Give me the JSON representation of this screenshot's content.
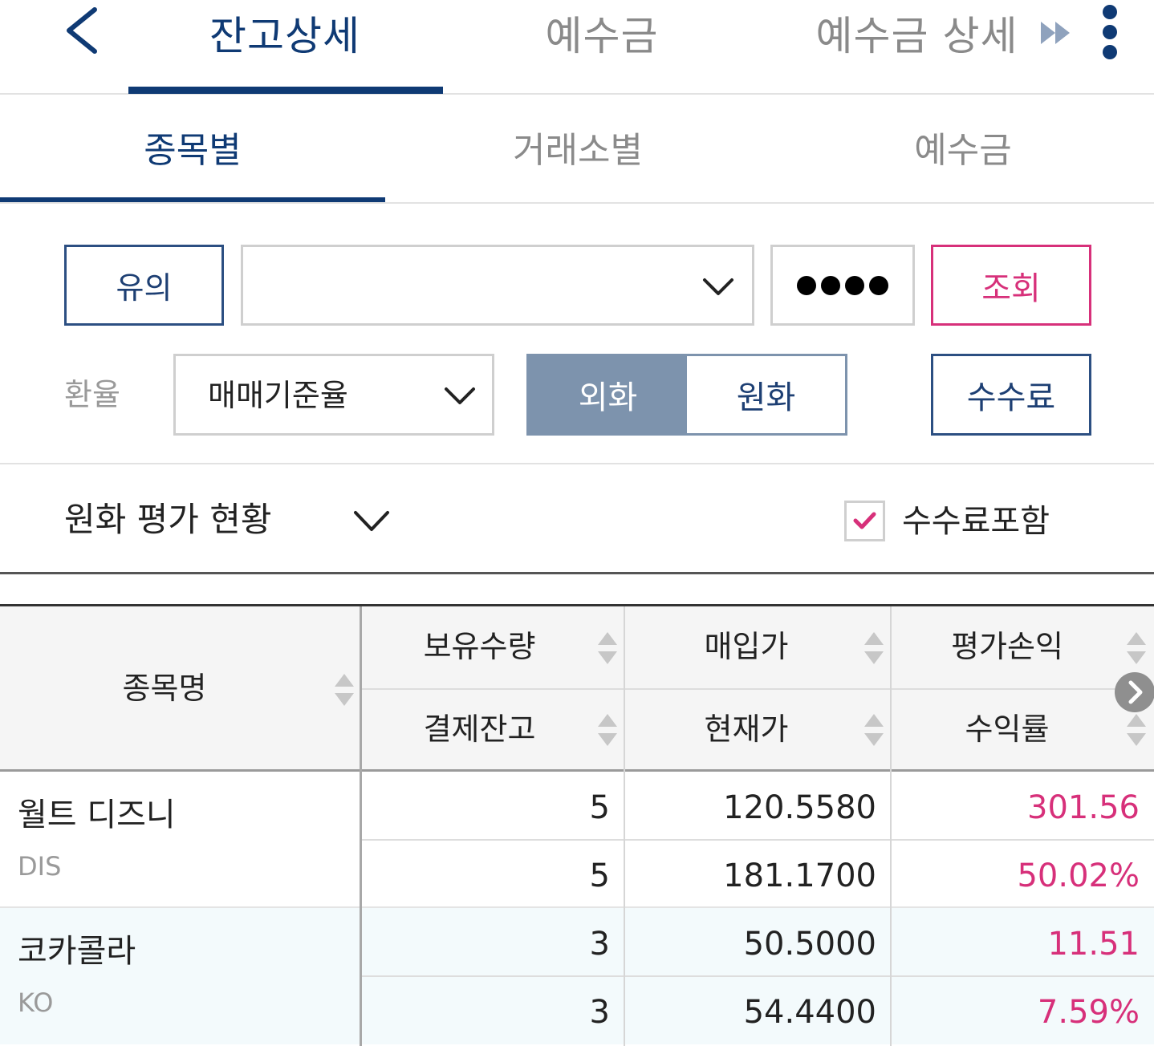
{
  "top_tabs": [
    {
      "label": "잔고상세",
      "active": true
    },
    {
      "label": "예수금",
      "active": false
    },
    {
      "label": "예수금 상세",
      "active": false
    }
  ],
  "sub_tabs": [
    {
      "label": "종목별",
      "active": true
    },
    {
      "label": "거래소별",
      "active": false
    },
    {
      "label": "예수금",
      "active": false
    }
  ],
  "controls": {
    "notice_label": "유의",
    "account_value": "",
    "password_dots": 4,
    "query_label": "조회",
    "fx_label": "환율",
    "fx_select_value": "매매기준율",
    "currency_toggle": [
      {
        "label": "외화",
        "selected": true
      },
      {
        "label": "원화",
        "selected": false
      }
    ],
    "fee_label": "수수료"
  },
  "summary": {
    "title": "원화 평가 현황",
    "fee_include_label": "수수료포함",
    "fee_include_checked": true
  },
  "table": {
    "headers": {
      "name": "종목명",
      "col1_top": "보유수량",
      "col1_bottom": "결제잔고",
      "col2_top": "매입가",
      "col2_bottom": "현재가",
      "col3_top": "평가손익",
      "col3_bottom": "수익률"
    },
    "rows": [
      {
        "name": "월트 디즈니",
        "code": "DIS",
        "qty": "5",
        "settle": "5",
        "buy_price": "120.5580",
        "current_price": "181.1700",
        "pnl": "301.56",
        "return_rate": "50.02%"
      },
      {
        "name": "코카콜라",
        "code": "KO",
        "qty": "3",
        "settle": "3",
        "buy_price": "50.5000",
        "current_price": "54.4400",
        "pnl": "11.51",
        "return_rate": "7.59%"
      }
    ]
  },
  "colors": {
    "navy": "#0f3a74",
    "accent_pink": "#d7307a",
    "toggle_gray": "#7d93ad"
  },
  "icons": {
    "back": "chevron-left-icon",
    "forward": "fast-forward-icon",
    "more": "more-vertical-icon",
    "dropdown": "chevron-down-icon",
    "sort": "sort-icon",
    "check": "check-icon",
    "next": "chevron-right-icon"
  }
}
